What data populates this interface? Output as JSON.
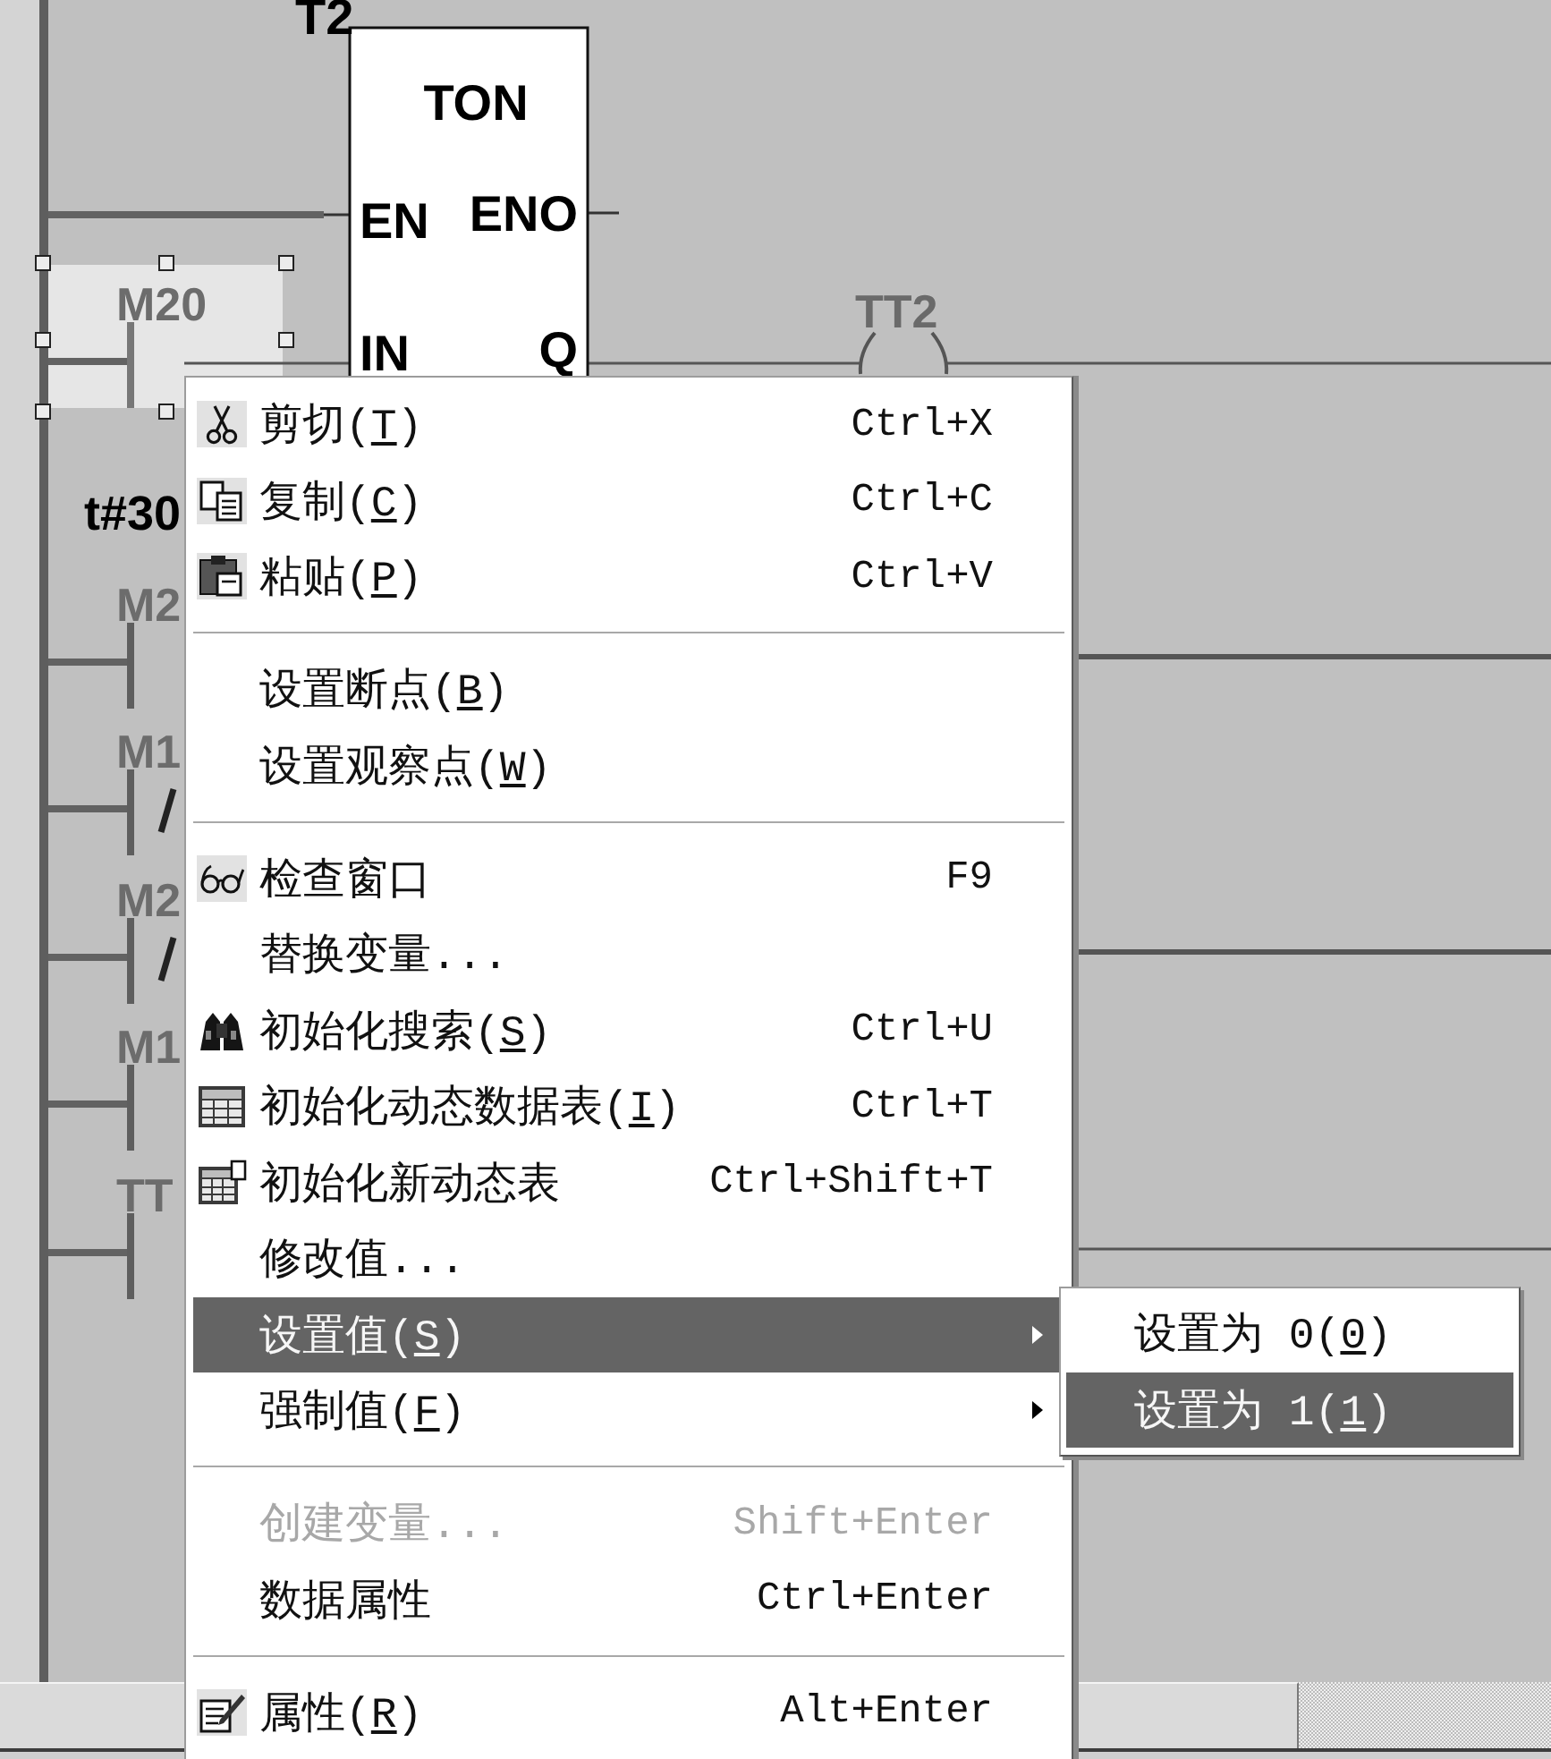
{
  "ladder": {
    "timer": {
      "name": "T2",
      "type": "TON",
      "pins": {
        "en": "EN",
        "eno": "ENO",
        "in": "IN",
        "q": "Q"
      },
      "preset": "t#30"
    },
    "contacts": [
      {
        "label": "M20",
        "kind": "normally_open",
        "selected": true
      },
      {
        "label": "M2",
        "kind": "normally_open",
        "selected": false
      },
      {
        "label": "M1",
        "kind": "normally_closed",
        "selected": false
      },
      {
        "label": "M2",
        "kind": "normally_closed",
        "selected": false
      },
      {
        "label": "M1",
        "kind": "normally_open",
        "selected": false
      },
      {
        "label": "TT",
        "kind": "normally_open",
        "selected": false
      }
    ],
    "coils": [
      {
        "label": "TT2"
      }
    ]
  },
  "context_menu": {
    "sections": [
      {
        "items": [
          {
            "label": "剪切(T)",
            "underline_key": true,
            "shortcut": "Ctrl+X",
            "selected": false,
            "disabled": false,
            "has_submenu": false
          },
          {
            "label": "复制(C)",
            "underline_key": true,
            "shortcut": "Ctrl+C",
            "selected": false,
            "disabled": false,
            "has_submenu": false
          },
          {
            "label": "粘贴(P)",
            "underline_key": true,
            "shortcut": "Ctrl+V",
            "selected": false,
            "disabled": false,
            "has_submenu": false
          }
        ]
      },
      {
        "items": [
          {
            "label": "设置断点(B)",
            "underline_key": true,
            "selected": false,
            "disabled": false,
            "has_submenu": false
          },
          {
            "label": "设置观察点(W)",
            "underline_key": true,
            "selected": false,
            "disabled": false,
            "has_submenu": false
          }
        ]
      },
      {
        "items": [
          {
            "label": "检查窗口",
            "underline_key": false,
            "shortcut": "F9",
            "selected": false,
            "disabled": false,
            "has_submenu": false
          },
          {
            "label": "替换变量...",
            "underline_key": false,
            "selected": false,
            "disabled": false,
            "has_submenu": false
          },
          {
            "label": "初始化搜索(S)",
            "underline_key": true,
            "shortcut": "Ctrl+U",
            "selected": false,
            "disabled": false,
            "has_submenu": false
          },
          {
            "label": "初始化动态数据表(I)",
            "underline_key": true,
            "shortcut": "Ctrl+T",
            "selected": false,
            "disabled": false,
            "has_submenu": false
          },
          {
            "label": "初始化新动态表",
            "underline_key": false,
            "shortcut": "Ctrl+Shift+T",
            "selected": false,
            "disabled": false,
            "has_submenu": false
          },
          {
            "label": "修改值...",
            "underline_key": false,
            "selected": false,
            "disabled": false,
            "has_submenu": false
          },
          {
            "label": "设置值(S)",
            "underline_key": true,
            "selected": true,
            "disabled": false,
            "has_submenu": true
          },
          {
            "label": "强制值(F)",
            "underline_key": true,
            "selected": false,
            "disabled": false,
            "has_submenu": true
          }
        ]
      },
      {
        "items": [
          {
            "label": "创建变量...",
            "underline_key": false,
            "shortcut": "Shift+Enter",
            "selected": false,
            "disabled": true,
            "has_submenu": false
          },
          {
            "label": "数据属性",
            "underline_key": false,
            "shortcut": "Ctrl+Enter",
            "selected": false,
            "disabled": false,
            "has_submenu": false
          }
        ]
      },
      {
        "items": [
          {
            "label": "属性(R)",
            "underline_key": true,
            "shortcut": "Alt+Enter",
            "selected": false,
            "disabled": false,
            "has_submenu": false
          }
        ]
      }
    ]
  },
  "submenu": {
    "items": [
      {
        "label": "设置为 0(0)",
        "underline_key": true,
        "selected": false
      },
      {
        "label": "设置为 1(1)",
        "underline_key": true,
        "selected": true
      }
    ]
  }
}
